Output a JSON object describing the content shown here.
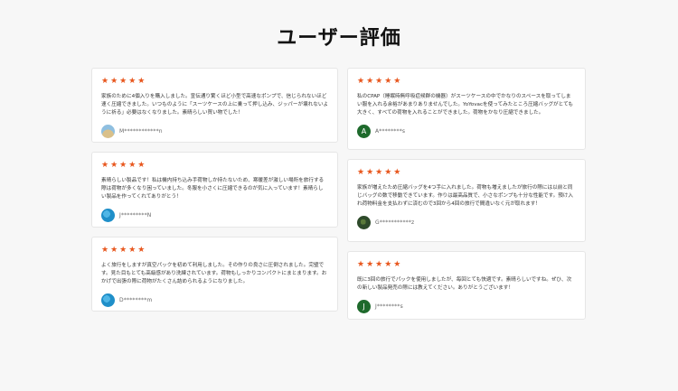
{
  "page": {
    "title": "ユーザー評価"
  },
  "stars": "★★★★★",
  "left_reviews": [
    {
      "text": "家族のために4個入りを購入しました。宣伝通り驚くほど小型で高速なポンプで、信じられないほど速く圧縮できました。いつものように「スーツケースの上に乗って押し込み、ジッパーが壊れないように祈る」必要はなくなりました。素晴らしい買い物でした！",
      "user": "M************n",
      "avatar": {
        "type": "photo",
        "color": "#8fbfe0",
        "letter": ""
      }
    },
    {
      "text": "素晴らしい製品です！私は機内持ち込み手荷物しか持たないため、寒暖差が激しい場所を旅行する際は荷物が多くなり困っていました。冬服を小さくに圧縮できるのが気に入っています！素晴らしい製品を作ってくれてありがとう！",
      "user": "J*********N",
      "avatar": {
        "type": "photo",
        "color": "#1f8fc9",
        "letter": ""
      }
    },
    {
      "text": "よく旅行をしますが真空パックを初めて利用しました。その作りの良さに圧倒されました。完璧です。見た目もとても高級感があり洗練されています。荷物もしっかりコンパクトにまとまります。おかげで出張の際に荷物がたくさん詰められるようになりました。",
      "user": "D********m",
      "avatar": {
        "type": "photo",
        "color": "#1f8fc9",
        "letter": ""
      }
    }
  ],
  "right_reviews": [
    {
      "text": "私のCPAP（睡眠時無呼吸症候群の機器）がスーツケースの中でかなりのスペースを取ってしまい服を入れる余裕があまりありませんでした。YoYovacを使ってみたところ圧縮バッグがとても大きく、すべての荷物を入れることができました。荷物をかなり圧縮できました。",
      "user": "A********s",
      "avatar": {
        "type": "letter",
        "color": "#1e6a2c",
        "letter": "A"
      }
    },
    {
      "text": "家族が増えたため圧縮バッグを4つ手に入れました。荷物も増えましたが旅行の際には以前と同じバッグの数で移動できています。作りは最高品質で、小さなポンプも十分な性能です。預け入れ荷物料金を支払わずに済むので3回から4回の旅行で間違いなく元が取れます！",
      "user": "G***********z",
      "avatar": {
        "type": "photo",
        "color": "#2e4a2a",
        "letter": ""
      }
    },
    {
      "text": "既に3回の旅行でパックを使用しましたが、毎回とても快適です。素晴らしいですね。ぜひ、次の新しい製品発売の際には教えてください。ありがとうございます！",
      "user": "J********s",
      "avatar": {
        "type": "letter",
        "color": "#1e6a2c",
        "letter": "J"
      }
    }
  ],
  "colors": {
    "star": "#e8571e",
    "card_border": "#e6e6e6",
    "background": "#f7f7f7"
  }
}
